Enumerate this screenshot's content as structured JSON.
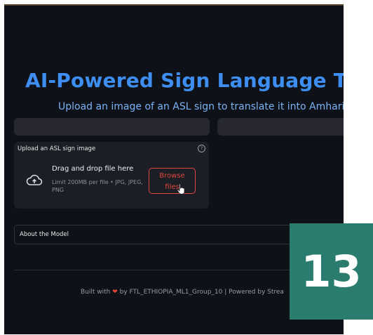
{
  "header": {
    "title": "AI-Powered Sign Language Trans",
    "subtitle": "Upload an image of an ASL sign to translate it into Amharic le"
  },
  "uploader": {
    "label": "Upload an ASL sign image",
    "help_icon": "question-circle-icon",
    "help_glyph": "?",
    "dropzone_icon": "cloud-upload-icon",
    "dropzone_title": "Drag and drop file here",
    "dropzone_limit": "Limit 200MB per file • JPG, JPEG, PNG",
    "browse_label_line1": "Browse",
    "browse_label_line2": "files"
  },
  "expander": {
    "label": "About the Model"
  },
  "footer": {
    "before_heart": "Built with ",
    "heart": "❤",
    "after_heart": " by FTL_ETHIOPIA_ML1_Group_10 | Powered by Strea"
  },
  "badge": {
    "number": "13"
  },
  "colors": {
    "background": "#0e1117",
    "title": "#3d8ef0",
    "subtitle": "#7ab3f5",
    "accent": "#e0453a",
    "badge": "#2a7c6f"
  }
}
